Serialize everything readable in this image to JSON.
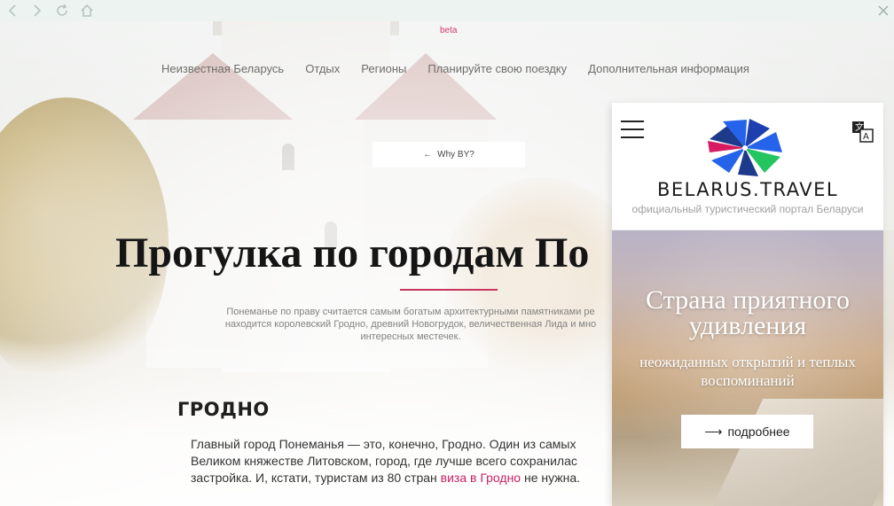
{
  "toolbar": {
    "back_icon": "chevron-left-icon",
    "forward_icon": "chevron-right-icon",
    "reload_icon": "reload-icon",
    "home_icon": "home-icon",
    "close_icon": "close-icon"
  },
  "site": {
    "beta_label": "beta",
    "nav": [
      "Неизвестная Беларусь",
      "Отдых",
      "Регионы",
      "Планируйте свою поездку",
      "Дополнительная информация"
    ],
    "why_button": "Why BY?",
    "headline": "Прогулка по городам По",
    "intro_lines": [
      "Понеманье по праву считается самым богатым архитектурными памятниками ре",
      "находится королевский Гродно, древний Новогрудок, величественная Лида и мно",
      "интересных местечек."
    ],
    "section_title": "ГРОДНО",
    "body_line1": "Главный город Понеманья — это, конечно, Гродно. Один из самых",
    "body_line2": "Великом княжестве Литовском, город, где лучше всего сохранилас",
    "body_line3_before": "застройка. И, кстати, туристам из 80 стран ",
    "body_line3_link": "виза в Гродно",
    "body_line3_after": " не нужна.",
    "accent_color": "#cc1f66"
  },
  "popup": {
    "brand": "BELARUS.TRAVEL",
    "tagline": "официальный туристический портал Беларуси",
    "hero_title": "Страна приятного удивления",
    "hero_subtitle": "неожиданных открытий и теплых воспоминаний",
    "more_button": "подробнее",
    "menu_icon": "hamburger-icon",
    "translate_icon": "translate-icon",
    "logo_colors": [
      "#1e3a8a",
      "#2563eb",
      "#d81b60",
      "#22c55e"
    ]
  }
}
